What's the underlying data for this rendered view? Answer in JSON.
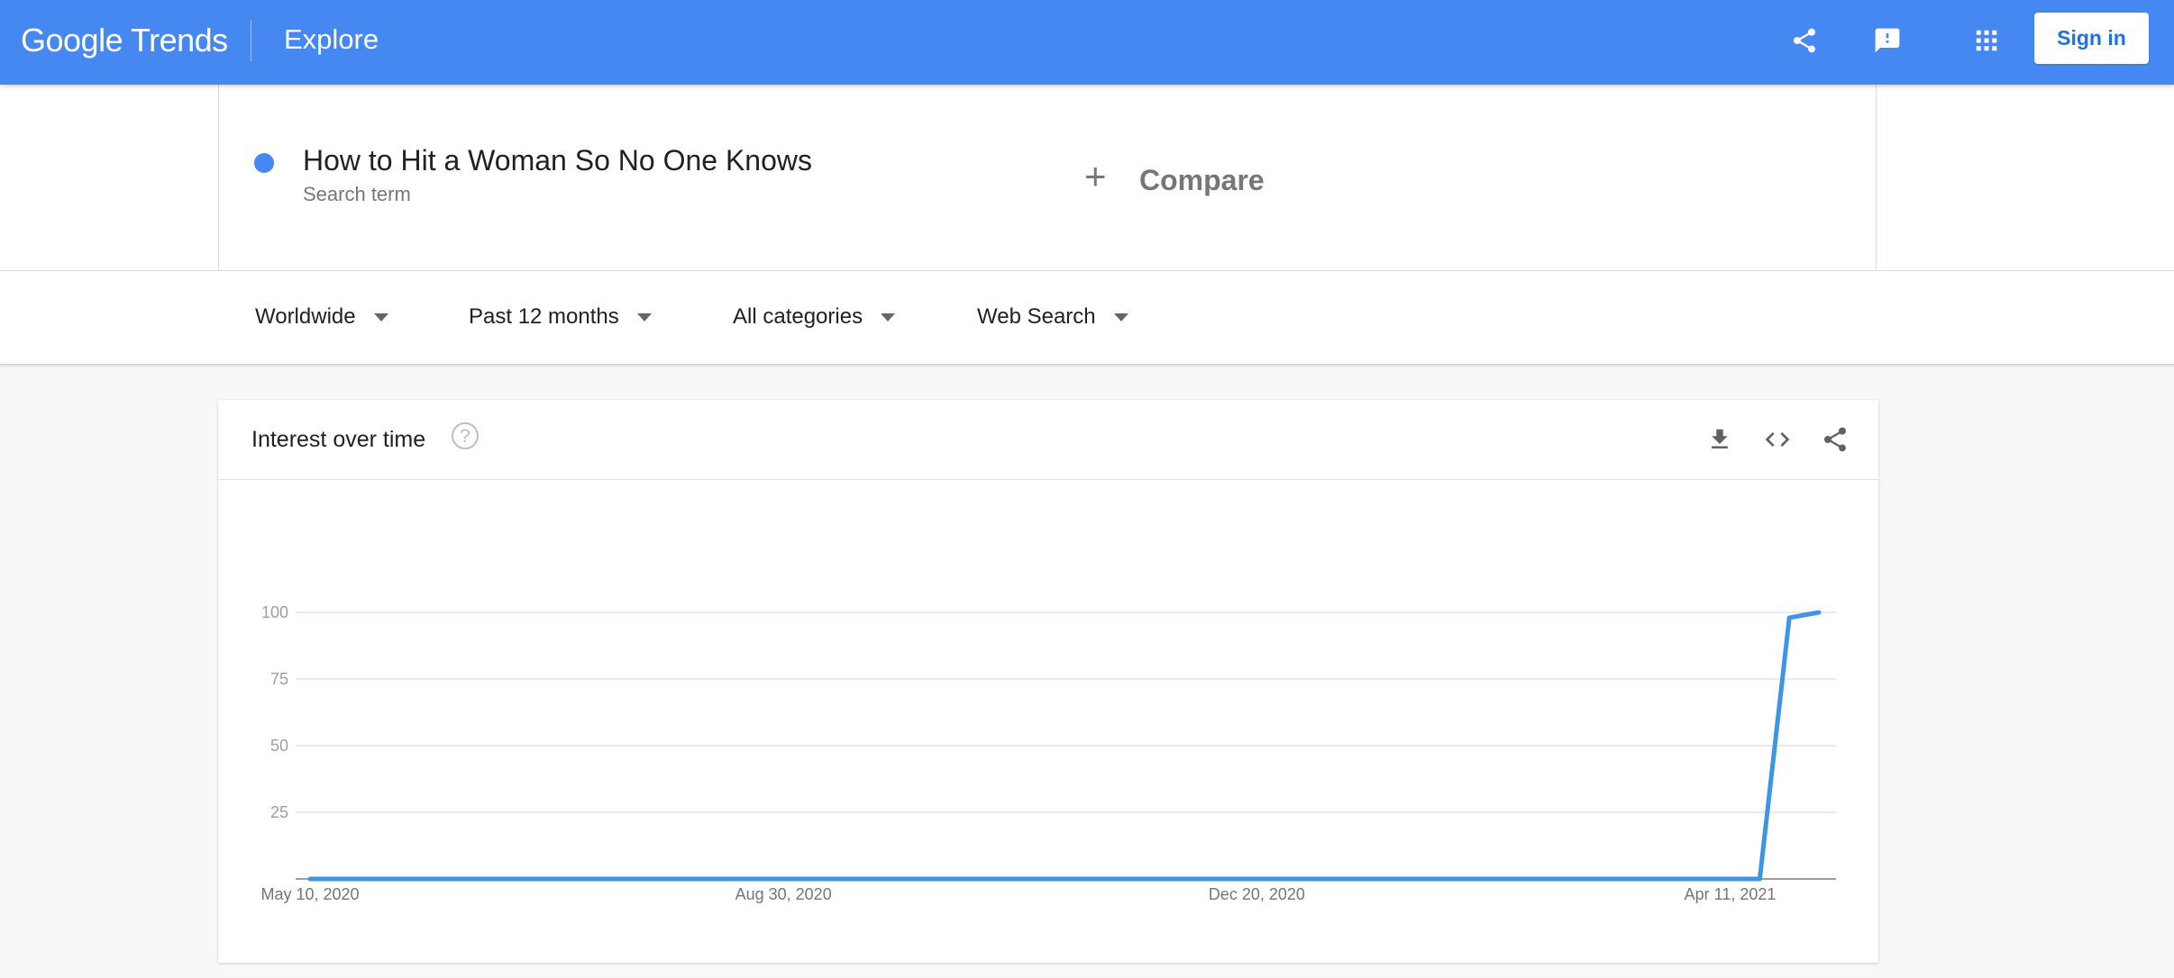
{
  "header": {
    "logo_google": "Google",
    "logo_trends": "Trends",
    "title": "Explore",
    "icons": [
      "share-icon",
      "feedback-icon",
      "apps-icon"
    ],
    "signin_label": "Sign in",
    "color": "#4688f1"
  },
  "search": {
    "term": "How to Hit a Woman So No One Knows",
    "term_sub": "Search term",
    "term_color": "#4688f1",
    "compare_plus": "+",
    "compare_label": "Compare"
  },
  "filters": [
    {
      "label": "Worldwide"
    },
    {
      "label": "Past 12 months"
    },
    {
      "label": "All categories"
    },
    {
      "label": "Web Search"
    }
  ],
  "card": {
    "title": "Interest over time",
    "help_glyph": "?",
    "icons": [
      "download-icon",
      "embed-icon",
      "share-icon"
    ]
  },
  "chart_data": {
    "type": "line",
    "x": [
      "2020-05-10",
      "2020-05-17",
      "2020-05-24",
      "2020-05-31",
      "2020-06-07",
      "2020-06-14",
      "2020-06-21",
      "2020-06-28",
      "2020-07-05",
      "2020-07-12",
      "2020-07-19",
      "2020-07-26",
      "2020-08-02",
      "2020-08-09",
      "2020-08-16",
      "2020-08-23",
      "2020-08-30",
      "2020-09-06",
      "2020-09-13",
      "2020-09-20",
      "2020-09-27",
      "2020-10-04",
      "2020-10-11",
      "2020-10-18",
      "2020-10-25",
      "2020-11-01",
      "2020-11-08",
      "2020-11-15",
      "2020-11-22",
      "2020-11-29",
      "2020-12-06",
      "2020-12-13",
      "2020-12-20",
      "2020-12-27",
      "2021-01-03",
      "2021-01-10",
      "2021-01-17",
      "2021-01-24",
      "2021-01-31",
      "2021-02-07",
      "2021-02-14",
      "2021-02-21",
      "2021-02-28",
      "2021-03-07",
      "2021-03-14",
      "2021-03-21",
      "2021-03-28",
      "2021-04-04",
      "2021-04-11",
      "2021-04-18",
      "2021-04-25",
      "2021-05-02"
    ],
    "series": [
      {
        "values": [
          0,
          0,
          0,
          0,
          0,
          0,
          0,
          0,
          0,
          0,
          0,
          0,
          0,
          0,
          0,
          0,
          0,
          0,
          0,
          0,
          0,
          0,
          0,
          0,
          0,
          0,
          0,
          0,
          0,
          0,
          0,
          0,
          0,
          0,
          0,
          0,
          0,
          0,
          0,
          0,
          0,
          0,
          0,
          0,
          0,
          0,
          0,
          0,
          0,
          0,
          98,
          100
        ],
        "color": "#3c95e5"
      }
    ],
    "x_ticks": [
      {
        "date": "2020-05-10",
        "label": "May 10, 2020"
      },
      {
        "date": "2020-08-30",
        "label": "Aug 30, 2020"
      },
      {
        "date": "2020-12-20",
        "label": "Dec 20, 2020"
      },
      {
        "date": "2021-04-11",
        "label": "Apr 11, 2021"
      }
    ],
    "y_ticks": [
      25,
      50,
      75,
      100
    ],
    "ylim": [
      0,
      100
    ],
    "grid": true,
    "xlabel": "",
    "ylabel": ""
  }
}
